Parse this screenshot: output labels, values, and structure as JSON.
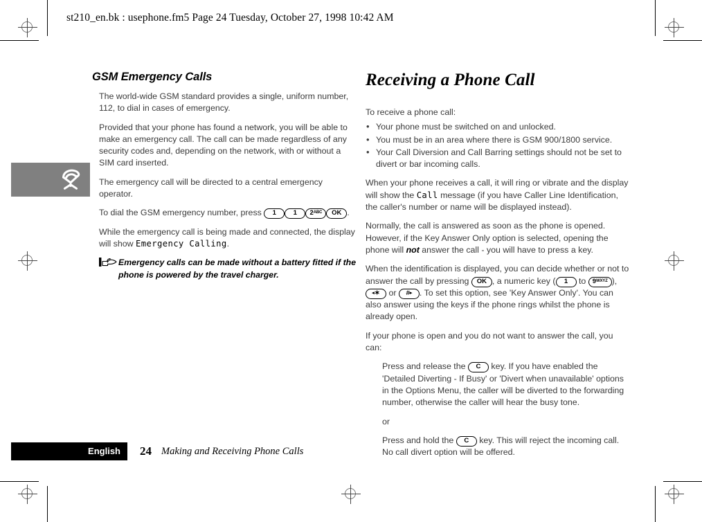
{
  "page_header": "st210_en.bk : usephone.fm5  Page 24  Tuesday, October 27, 1998  10:42 AM",
  "colors": {
    "sidebar_tab": "#808080",
    "footer_bar": "#000000",
    "body_text": "#3a3a3a"
  },
  "sidebar_tab": {
    "icon": "telephone-handset-icon"
  },
  "left_column": {
    "heading": "GSM Emergency Calls",
    "paragraphs": {
      "p1": "The world-wide GSM standard provides a single, uniform number, 112, to dial in cases of emergency.",
      "p2": "Provided that your phone has found a network, you will be able to make an emergency call. The call can be made regardless of any security codes and, depending on the network, with or without a SIM card inserted.",
      "p3": "The emergency call will be directed to a central emergency operator.",
      "p4_prefix": "To dial the GSM emergency number, press ",
      "p4_suffix": ".",
      "p5_prefix": "While the emergency call is being made and connected, the display will show ",
      "p5_display": "Emergency Calling",
      "p5_suffix": "."
    },
    "keys_dial": [
      {
        "label": "1",
        "sub": ""
      },
      {
        "label": "1",
        "sub": ""
      },
      {
        "label": "2",
        "sub": "ABC"
      },
      {
        "label": "OK",
        "sub": ""
      }
    ],
    "note": "Emergency calls can be made without a battery fitted if the phone is powered by the travel charger.",
    "note_icon": "pointing-hand-icon"
  },
  "right_column": {
    "heading": "Receiving a Phone Call",
    "intro": "To receive a phone call:",
    "bullets": [
      "Your phone must be switched on and unlocked.",
      "You must be in an area where there is GSM 900/1800 service.",
      "Your Call Diversion and Call Barring settings should not be set to divert or bar incoming calls."
    ],
    "p_ring_prefix": "When your phone receives a call, it will ring or vibrate and the display will show the ",
    "p_ring_display": "Call",
    "p_ring_suffix": " message (if you have Caller Line Identification, the caller's number or name will be displayed instead).",
    "p_normally_a": "Normally, the call is answered as soon as the phone is opened. However, if the Key Answer Only option is selected, opening the phone will ",
    "p_normally_bold": "not",
    "p_normally_b": " answer the call - you will have to press a key.",
    "p_ident_a": "When the identification is displayed, you can decide whether or not to answer the call by pressing ",
    "p_ident_b": ", a numeric key (",
    "p_ident_c": " to ",
    "p_ident_d": "), ",
    "p_ident_e": " or ",
    "p_ident_f": ". To set this option, see 'Key Answer Only'. You can also answer using the keys if the phone rings whilst the phone is already open.",
    "keys_ident": {
      "ok": {
        "label": "OK",
        "sub": ""
      },
      "one": {
        "label": "1",
        "sub": ""
      },
      "nine": {
        "label": "9",
        "sub": "WXYZ"
      },
      "star": {
        "label": "✶",
        "arrow": "◂"
      },
      "hash": {
        "label": "#",
        "arrow": "▸"
      }
    },
    "p_open": "If your phone is open and you do not want to answer the call, you can:",
    "p_press_release_a": "Press and release the ",
    "p_press_release_b": " key. If you have enabled the 'Detailed Diverting - If Busy' or 'Divert when unavailable' options in the Options Menu, the caller will be diverted to the forwarding number, otherwise the caller will hear the busy tone.",
    "p_or": "or",
    "p_press_hold_a": "Press and hold the ",
    "p_press_hold_b": " key. This will reject the incoming call. No call divert option will be offered.",
    "key_clear": {
      "label": "C",
      "sub": ""
    }
  },
  "footer": {
    "language": "English",
    "page_number": "24",
    "chapter": "Making and Receiving Phone Calls"
  }
}
